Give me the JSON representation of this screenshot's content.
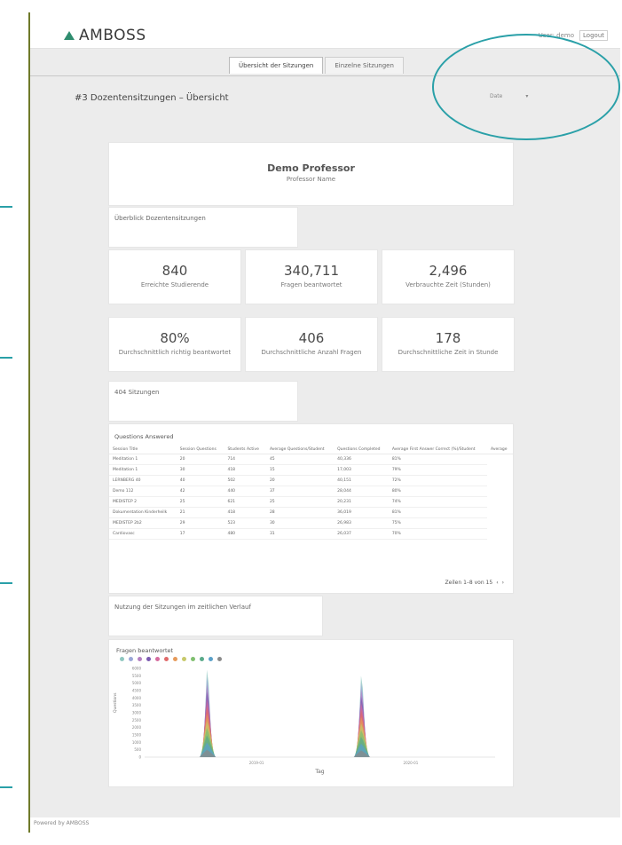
{
  "app": {
    "brand": "AMBOSS",
    "user_label": "User: demo",
    "logout_label": "Logout"
  },
  "tabs": [
    {
      "label": "Übersicht der Sitzungen"
    },
    {
      "label": "Einzelne Sitzungen"
    }
  ],
  "page": {
    "title": "#3 Dozentensitzungen – Übersicht",
    "date_label": "Date",
    "date_chevron": "▾"
  },
  "professor": {
    "name": "Demo Professor",
    "subtitle": "Professor Name"
  },
  "sections": {
    "overview": "Überblick Dozentensitzungen",
    "sessions": "404 Sitzungen",
    "usage": "Nutzung der Sitzungen im zeitlichen Verlauf"
  },
  "kpis": [
    {
      "value": "840",
      "label": "Erreichte Studierende"
    },
    {
      "value": "340,711",
      "label": "Fragen beantwortet"
    },
    {
      "value": "2,496",
      "label": "Verbrauchte Zeit (Stunden)"
    },
    {
      "value": "80%",
      "label": "Durchschnittlich richtig beantwortet"
    },
    {
      "value": "406",
      "label": "Durchschnittliche Anzahl Fragen"
    },
    {
      "value": "178",
      "label": "Durchschnittliche Zeit in Stunde"
    }
  ],
  "questions_table": {
    "title": "Questions Answered",
    "headers": [
      "Session Title",
      "Session Questions",
      "Students Active",
      "Average Questions/Student",
      "Questions Completed",
      "Average First Answer Correct (%)/Student",
      "Average"
    ],
    "rows": [
      [
        "Meditation 1",
        "20",
        "714",
        "45",
        "40,336",
        "81%"
      ],
      [
        "Meditation 1",
        "30",
        "418",
        "15",
        "17,003",
        "79%"
      ],
      [
        "LERNBERG 40",
        "40",
        "502",
        "20",
        "40,151",
        "72%"
      ],
      [
        "Demo 112",
        "42",
        "440",
        "37",
        "28,044",
        "80%"
      ],
      [
        "MEDISTEP 2",
        "25",
        "621",
        "25",
        "20,231",
        "74%"
      ],
      [
        "Dokumentation Kinderheilk",
        "21",
        "418",
        "28",
        "36,019",
        "81%"
      ],
      [
        "MEDISTEP 2b2",
        "29",
        "523",
        "30",
        "26,983",
        "75%"
      ],
      [
        "Cardiovasc",
        "17",
        "480",
        "31",
        "26,037",
        "70%"
      ]
    ],
    "pager": "Zeilen 1–8 von 15",
    "prev": "‹",
    "next": "›"
  },
  "chart": {
    "title": "Fragen beantwortet",
    "ylabel": "Questions",
    "xlabel": "Tag",
    "legend_colors": [
      "#8fc7c0",
      "#9ba7d8",
      "#b47fc0",
      "#7a5ab0",
      "#d66b9e",
      "#e06a6a",
      "#e69a5a",
      "#c7c96a",
      "#7fbf6f",
      "#5aaa8a",
      "#5aa0c8",
      "#8a8a8a"
    ]
  },
  "chart_data": {
    "type": "area",
    "title": "Fragen beantwortet",
    "xlabel": "Tag",
    "ylabel": "Questions",
    "x_ticks": [
      "2019-01",
      "2020-01"
    ],
    "y_ticks": [
      0,
      500,
      1000,
      1500,
      2000,
      2500,
      3000,
      3500,
      4000,
      4500,
      5000,
      5500,
      6000
    ],
    "ylim": [
      0,
      6000
    ],
    "peaks": [
      {
        "x": "2019-01",
        "value": 5900
      },
      {
        "x": "2020-01",
        "value": 5500
      }
    ]
  },
  "footer": "Powered by AMBOSS"
}
